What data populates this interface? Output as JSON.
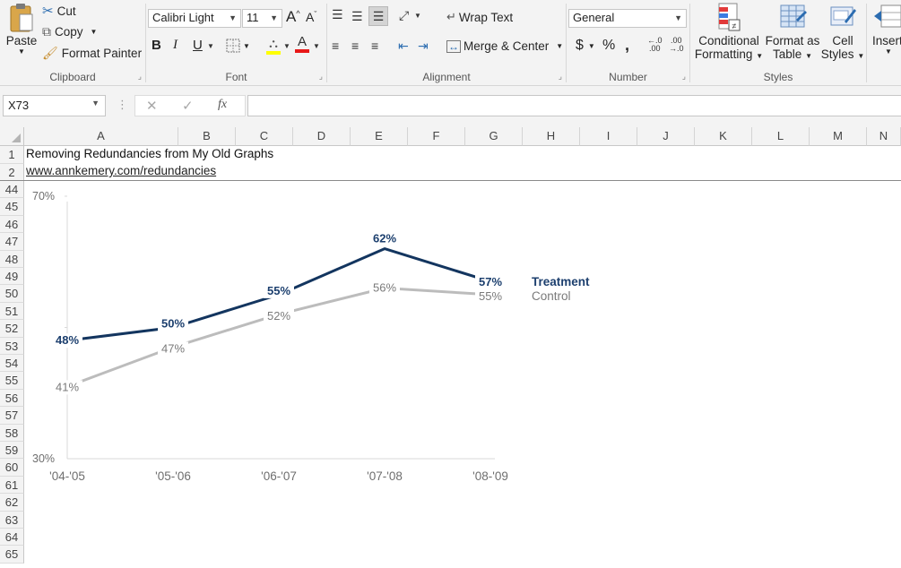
{
  "ribbon": {
    "clipboard": {
      "paste_label": "Paste",
      "cut_label": "Cut",
      "copy_label": "Copy",
      "format_painter_label": "Format Painter",
      "group_label": "Clipboard"
    },
    "font": {
      "font_name": "Calibri Light",
      "font_size": "11",
      "bold": "B",
      "italic": "I",
      "underline": "U",
      "grow": "A",
      "shrink": "A",
      "group_label": "Font",
      "fill_color": "#ffff00",
      "font_color": "#ff0000"
    },
    "alignment": {
      "wrap_text_label": "Wrap Text",
      "merge_label": "Merge & Center",
      "group_label": "Alignment"
    },
    "number": {
      "format": "General",
      "currency": "$",
      "percent": "%",
      "comma": ",",
      "group_label": "Number"
    },
    "styles": {
      "conditional_line1": "Conditional",
      "conditional_line2": "Formatting",
      "format_table_line1": "Format as",
      "format_table_line2": "Table",
      "cell_styles_line1": "Cell",
      "cell_styles_line2": "Styles",
      "group_label": "Styles"
    },
    "cells": {
      "insert_label": "Insert"
    }
  },
  "formula_bar": {
    "name_box": "X73",
    "fx": "fx",
    "formula": ""
  },
  "columns": [
    "A",
    "B",
    "C",
    "D",
    "E",
    "F",
    "G",
    "H",
    "I",
    "J",
    "K",
    "L",
    "M",
    "N"
  ],
  "rows": [
    "1",
    "2",
    "44",
    "45",
    "46",
    "47",
    "48",
    "49",
    "50",
    "51",
    "52",
    "53",
    "54",
    "55",
    "56",
    "57",
    "58",
    "59",
    "60",
    "61",
    "62",
    "63",
    "64",
    "65"
  ],
  "cells": {
    "a1": "Removing Redundancies from My Old Graphs",
    "a2": "www.annkemery.com/redundancies"
  },
  "chart_data": {
    "type": "line",
    "categories": [
      "'04-'05",
      "'05-'06",
      "'06-'07",
      "'07-'08",
      "'08-'09"
    ],
    "series": [
      {
        "name": "Treatment",
        "values": [
          48,
          50,
          55,
          62,
          57
        ],
        "labels": [
          "48%",
          "50%",
          "55%",
          "62%",
          "57%"
        ],
        "color": "#13355f"
      },
      {
        "name": "Control",
        "values": [
          41,
          47,
          52,
          56,
          55
        ],
        "labels": [
          "41%",
          "47%",
          "52%",
          "56%",
          "55%"
        ],
        "color": "#bcbcbc"
      }
    ],
    "ylim": [
      30,
      70
    ],
    "y_tick_labels": [
      "30%",
      "70%"
    ],
    "title": "",
    "xlabel": "",
    "ylabel": "",
    "legend": "inline-right",
    "grid": false
  }
}
